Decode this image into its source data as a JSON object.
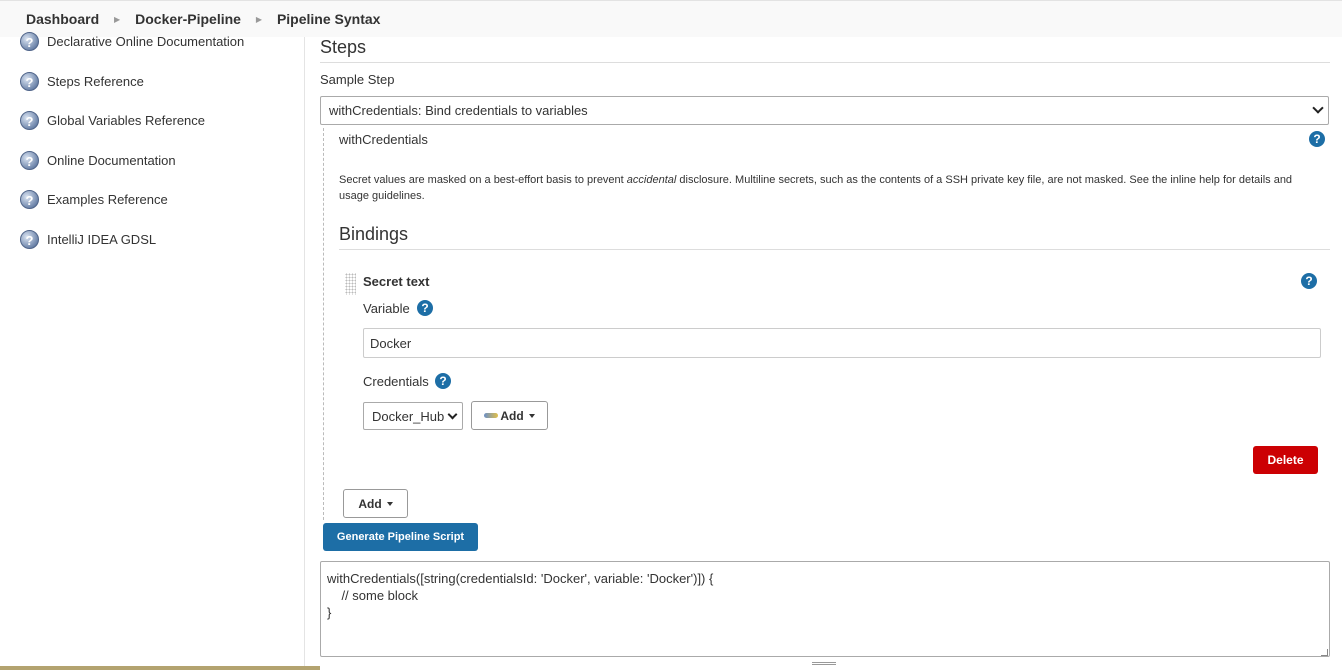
{
  "breadcrumb": [
    "Dashboard",
    "Docker-Pipeline",
    "Pipeline Syntax"
  ],
  "sidebar": {
    "items": [
      {
        "label": "Declarative Online Documentation"
      },
      {
        "label": "Steps Reference"
      },
      {
        "label": "Global Variables Reference"
      },
      {
        "label": "Online Documentation"
      },
      {
        "label": "Examples Reference"
      },
      {
        "label": "IntelliJ IDEA GDSL"
      }
    ]
  },
  "steps": {
    "heading": "Steps",
    "sample_step_label": "Sample Step",
    "sample_step_value": "withCredentials: Bind credentials to variables",
    "step_name": "withCredentials",
    "description_pre": "Secret values are masked on a best-effort basis to prevent ",
    "description_em": "accidental",
    "description_post": " disclosure. Multiline secrets, such as the contents of a SSH private key file, are not masked. See the inline help for details and usage guidelines."
  },
  "bindings": {
    "heading": "Bindings",
    "binding_title": "Secret text",
    "variable_label": "Variable",
    "variable_value": "Docker",
    "credentials_label": "Credentials",
    "credentials_value": "Docker_Hub",
    "add_cred_label": "Add",
    "delete_label": "Delete",
    "add_binding_label": "Add"
  },
  "generate_label": "Generate Pipeline Script",
  "script_output": "withCredentials([string(credentialsId: 'Docker', variable: 'Docker')]) {\n    // some block\n}",
  "colors": {
    "primary": "#1d6ea6",
    "danger": "#cc0003",
    "help_icon": "#1d6ea6"
  }
}
